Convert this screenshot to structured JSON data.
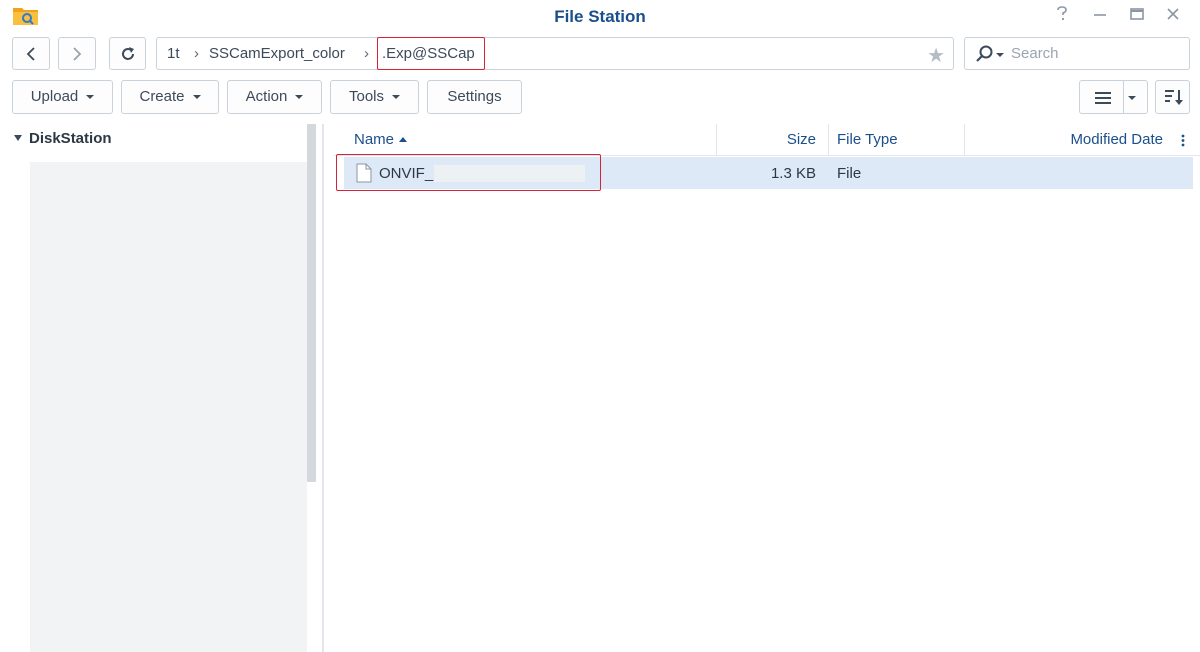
{
  "window": {
    "title": "File Station",
    "icon": "file-station-folder-icon",
    "controls": [
      "help-icon",
      "minimize-icon",
      "maximize-icon",
      "close-icon"
    ]
  },
  "nav": {
    "back_icon": "chevron-left-icon",
    "forward_icon": "chevron-right-icon",
    "refresh_icon": "refresh-icon",
    "breadcrumb": [
      "1t",
      "SSCamExport_color",
      ".Exp@SSCap"
    ],
    "favorite_icon": "star-icon"
  },
  "search": {
    "placeholder": "Search",
    "icon": "search-icon"
  },
  "toolbar": {
    "upload": "Upload",
    "create": "Create",
    "action": "Action",
    "tools": "Tools",
    "settings": "Settings",
    "view_icon": "list-view-icon",
    "sort_icon": "sort-icon"
  },
  "sidebar": {
    "root": "DiskStation"
  },
  "grid": {
    "columns": [
      "Name",
      "Size",
      "File Type",
      "Modified Date"
    ],
    "sort_column": "Name",
    "sort_direction": "ascending",
    "rows": [
      {
        "name": "ONVIF_",
        "size": "1.3 KB",
        "type": "File",
        "modified": ""
      }
    ]
  },
  "colors": {
    "title": "#1b4f8c",
    "selected_row": "#dde9f6",
    "annotation_red": "#d5243a"
  }
}
